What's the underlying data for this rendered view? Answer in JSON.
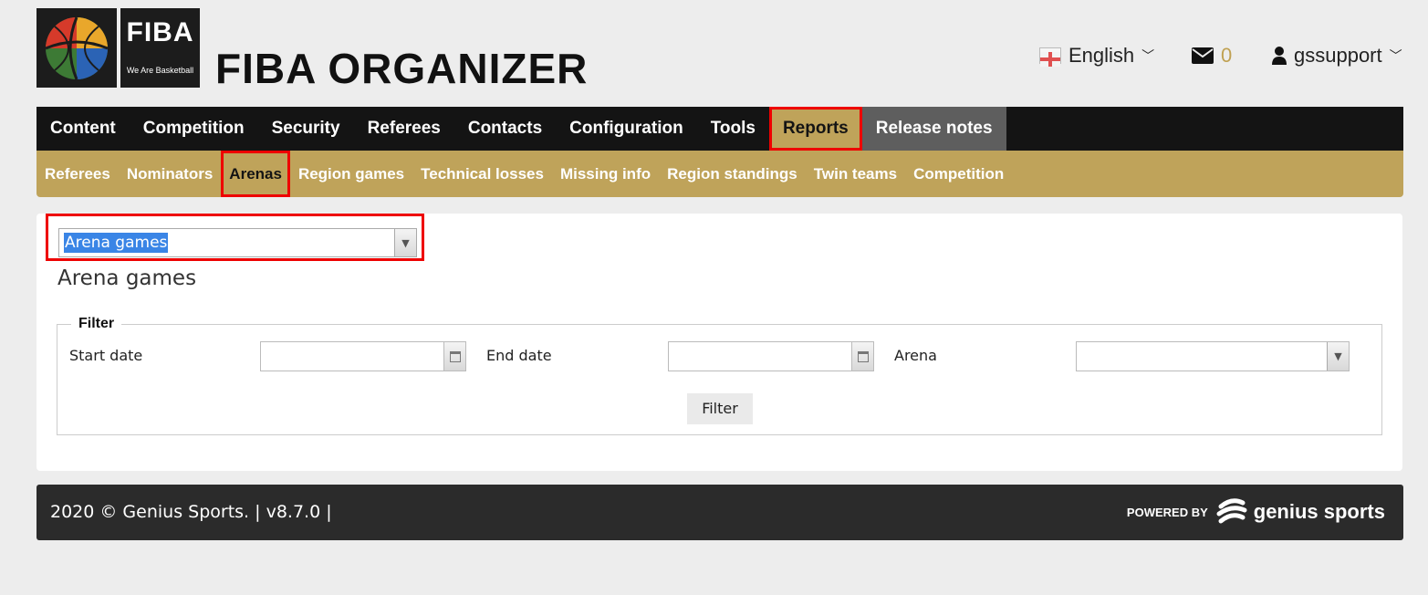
{
  "logo": {
    "big": "FIBA",
    "tagline": "We Are Basketball"
  },
  "app_title": "FIBA ORGANIZER",
  "header": {
    "language": "English",
    "messages_count": "0",
    "username": "gssupport"
  },
  "nav": {
    "items": [
      {
        "label": "Content"
      },
      {
        "label": "Competition"
      },
      {
        "label": "Security"
      },
      {
        "label": "Referees"
      },
      {
        "label": "Contacts"
      },
      {
        "label": "Configuration"
      },
      {
        "label": "Tools"
      },
      {
        "label": "Reports"
      },
      {
        "label": "Release notes"
      }
    ]
  },
  "subnav": {
    "items": [
      {
        "label": "Referees"
      },
      {
        "label": "Nominators"
      },
      {
        "label": "Arenas"
      },
      {
        "label": "Region games"
      },
      {
        "label": "Technical losses"
      },
      {
        "label": "Missing info"
      },
      {
        "label": "Region standings"
      },
      {
        "label": "Twin teams"
      },
      {
        "label": "Competition"
      }
    ]
  },
  "report_select": {
    "value": "Arena games"
  },
  "page_title": "Arena games",
  "filter": {
    "legend": "Filter",
    "start_label": "Start date",
    "end_label": "End date",
    "arena_label": "Arena",
    "button": "Filter"
  },
  "footer": {
    "copyright": "2020 © Genius Sports. | v8.7.0 |",
    "powered_by": "POWERED BY",
    "brand": "genius sports"
  },
  "colors": {
    "gold": "#bfa35a",
    "nav_bg": "#141414",
    "highlight": "#e00000"
  }
}
